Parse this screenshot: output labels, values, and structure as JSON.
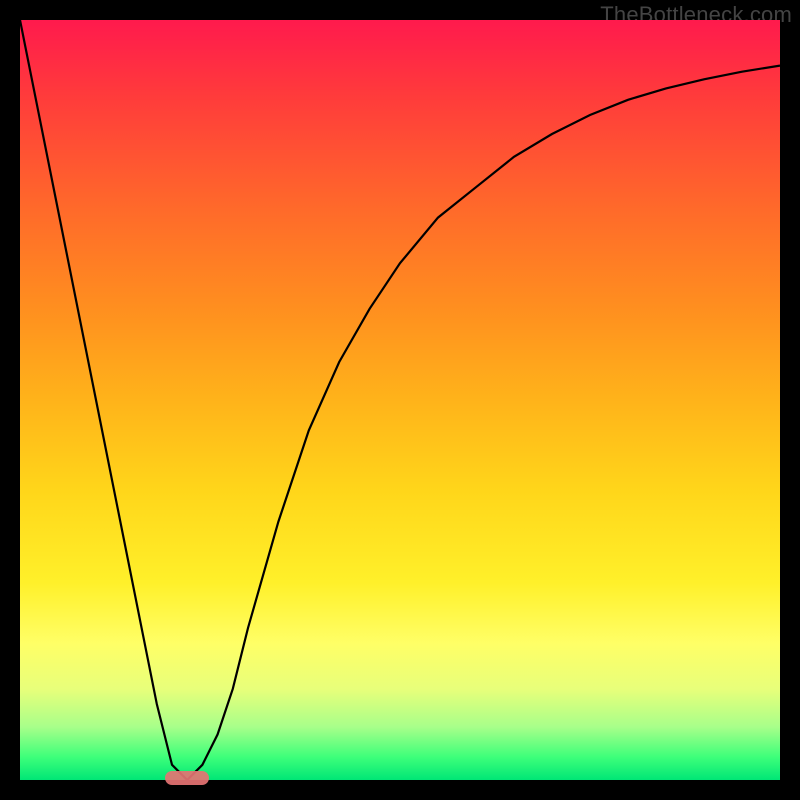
{
  "watermark": {
    "text": "TheBottleneck.com"
  },
  "colors": {
    "frame_border": "#000000",
    "curve_stroke": "#000000",
    "marker_fill": "#e57373"
  },
  "chart_data": {
    "type": "line",
    "title": "",
    "xlabel": "",
    "ylabel": "",
    "xlim": [
      0,
      100
    ],
    "ylim": [
      0,
      100
    ],
    "series": [
      {
        "name": "curve",
        "x": [
          0,
          5,
          10,
          14,
          18,
          20,
          22,
          24,
          26,
          28,
          30,
          34,
          38,
          42,
          46,
          50,
          55,
          60,
          65,
          70,
          75,
          80,
          85,
          90,
          95,
          100
        ],
        "y": [
          100,
          75,
          50,
          30,
          10,
          2,
          0,
          2,
          6,
          12,
          20,
          34,
          46,
          55,
          62,
          68,
          74,
          78,
          82,
          85,
          87.5,
          89.5,
          91,
          92.2,
          93.2,
          94
        ]
      }
    ],
    "annotations": [
      {
        "name": "bottom-marker",
        "x": 22,
        "y": 0,
        "shape": "pill",
        "color": "#e57373"
      }
    ],
    "watermark": "TheBottleneck.com"
  }
}
